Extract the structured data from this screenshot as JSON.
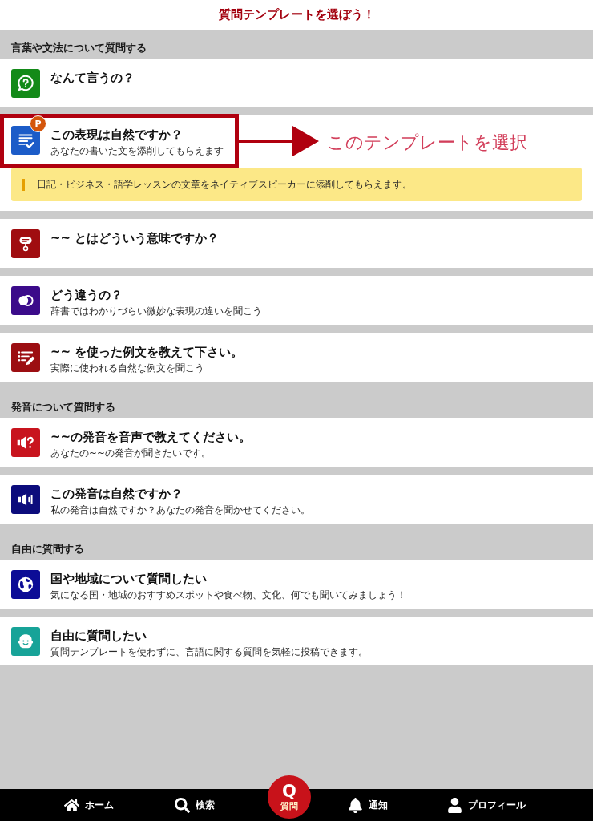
{
  "header": {
    "title": "質問テンプレートを選ぼう！"
  },
  "sections": [
    {
      "title": "言葉や文法について質問する",
      "items": [
        {
          "title": "なんて言うの？",
          "kind": "question-bubble",
          "color": "#138a18",
          "highlighted": false
        },
        {
          "title": "この表現は自然ですか？",
          "subtitle": "あなたの書いた文を添削してもらえます",
          "kind": "document-check",
          "color": "#1c5cc8",
          "badge": "P",
          "highlighted": true,
          "callout": "このテンプレートを選択",
          "note": "日記・ビジネス・語学レッスンの文章をネイティブスピーカーに添削してもらえます。"
        },
        {
          "title": "~~ とはどういう意味ですか？",
          "kind": "speech-balloon",
          "color": "#a00d10",
          "highlighted": false
        },
        {
          "title": "どう違うの？",
          "subtitle": "辞書ではわかりづらい微妙な表現の違いを聞こう",
          "kind": "compare",
          "color": "#3b0b8a",
          "highlighted": false
        },
        {
          "title": "~~ を使った例文を教えて下さい。",
          "subtitle": "実際に使われる自然な例文を聞こう",
          "kind": "list-edit",
          "color": "#9c0e12",
          "highlighted": false
        }
      ]
    },
    {
      "title": "発音について質問する",
      "items": [
        {
          "title": "~~の発音を音声で教えてください。",
          "subtitle": "あなたの~~の発音が聞きたいです。",
          "kind": "speaker-question",
          "color": "#c8141e",
          "highlighted": false
        },
        {
          "title": "この発音は自然ですか？",
          "subtitle": "私の発音は自然ですか？あなたの発音を聞かせてください。",
          "kind": "speaker",
          "color": "#0c0c7c",
          "highlighted": false
        }
      ]
    },
    {
      "title": "自由に質問する",
      "items": [
        {
          "title": "国や地域について質問したい",
          "subtitle": "気になる国・地域のおすすめスポットや食べ物、文化、何でも聞いてみましょう！",
          "kind": "globe",
          "color": "#0c0c96",
          "highlighted": false
        },
        {
          "title": "自由に質問したい",
          "subtitle": "質問テンプレートを使わずに、言語に関する質問を気軽に投稿できます。",
          "kind": "face",
          "color": "#17a398",
          "highlighted": false
        }
      ]
    }
  ],
  "nav": [
    {
      "kind": "home",
      "label": "ホーム"
    },
    {
      "kind": "search",
      "label": "検索"
    },
    {
      "kind": "ask",
      "symbol": "Q",
      "label": "質問"
    },
    {
      "kind": "bell",
      "label": "通知"
    },
    {
      "kind": "person",
      "label": "プロフィール"
    }
  ]
}
